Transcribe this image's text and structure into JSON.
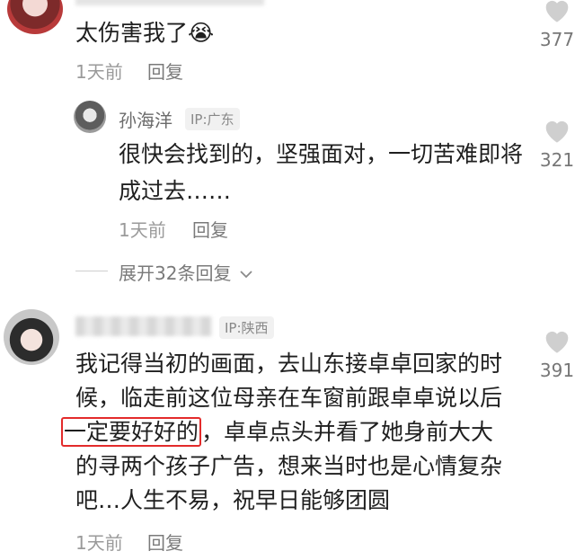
{
  "comment1": {
    "text": "太伤害我了😭",
    "time": "1天前",
    "reply_label": "回复",
    "likes": "377"
  },
  "reply1": {
    "username": "孙海洋",
    "ip": "IP:广东",
    "line1": "很快会找到的，坚强面对，一切苦难即将",
    "line2": "成过去……",
    "time": "1天前",
    "reply_label": "回复",
    "likes": "321"
  },
  "expand": {
    "label": "展开32条回复"
  },
  "comment2": {
    "ip": "IP:陕西",
    "line1": "我记得当初的画面，去山东接卓卓回家的时",
    "line2": "候，临走前这位母亲在车窗前跟卓卓说以后",
    "line3_highlight": "一定要好好的",
    "line3_rest": "，卓卓点头并看了她身前大大",
    "line4": "的寻两个孩子广告，想来当时也是心情复杂",
    "line5": "吧…人生不易，祝早日能够团圆",
    "time": "1天前",
    "reply_label": "回复",
    "likes": "391"
  },
  "colors": {
    "highlight_box": "#e32b2b",
    "meta_gray": "#9a9a9a"
  }
}
